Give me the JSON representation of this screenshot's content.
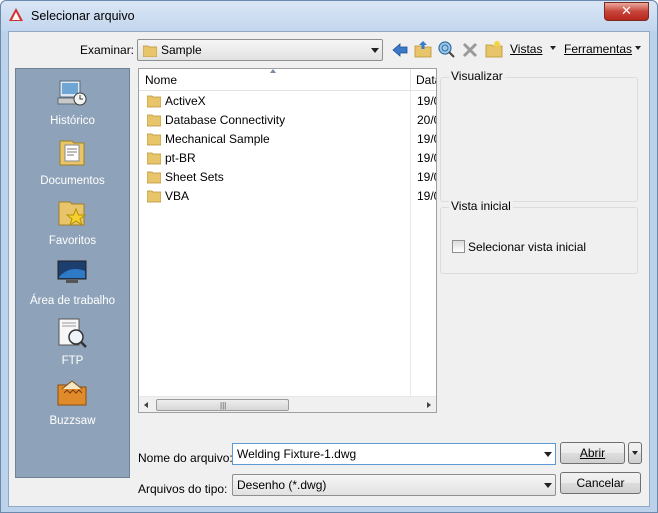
{
  "window": {
    "title": "Selecionar arquivo",
    "close_label": "✕",
    "app_icon": "autocad-icon"
  },
  "toolbar": {
    "look_in_label": "Examinar:",
    "look_in_value": "Sample",
    "back_icon": "back-arrow-icon",
    "up_folder_icon": "up-folder-icon",
    "search_web_icon": "search-web-icon",
    "delete_icon": "delete-icon",
    "new_folder_icon": "new-folder-icon",
    "views_label": "Vistas",
    "tools_label": "Ferramentas"
  },
  "places": [
    {
      "label": "Histórico",
      "icon": "history-icon"
    },
    {
      "label": "Documentos",
      "icon": "documents-icon"
    },
    {
      "label": "Favoritos",
      "icon": "favorites-icon"
    },
    {
      "label": "Área de trabalho",
      "icon": "desktop-icon"
    },
    {
      "label": "FTP",
      "icon": "ftp-icon"
    },
    {
      "label": "Buzzsaw",
      "icon": "buzzsaw-icon"
    }
  ],
  "file_list": {
    "columns": [
      "Nome",
      "Data"
    ],
    "rows": [
      {
        "name": "ActiveX",
        "date": "19/0"
      },
      {
        "name": "Database Connectivity",
        "date": "20/0"
      },
      {
        "name": "Mechanical Sample",
        "date": "19/0"
      },
      {
        "name": "pt-BR",
        "date": "19/0"
      },
      {
        "name": "Sheet Sets",
        "date": "19/0"
      },
      {
        "name": "VBA",
        "date": "19/0"
      }
    ]
  },
  "preview": {
    "title": "Visualizar"
  },
  "initial_view": {
    "title": "Vista inicial",
    "checkbox_label": "Selecionar vista inicial",
    "checked": false
  },
  "file_name": {
    "label": "Nome do arquivo:",
    "value": "Welding Fixture-1.dwg"
  },
  "file_type": {
    "label": "Arquivos do tipo:",
    "value": "Desenho (*.dwg)"
  },
  "buttons": {
    "open_label": "Abrir",
    "cancel_label": "Cancelar"
  },
  "colors": {
    "places_bg": "#8ea3b9",
    "folder": "#e8c56a",
    "accent": "#3c7fb1"
  }
}
